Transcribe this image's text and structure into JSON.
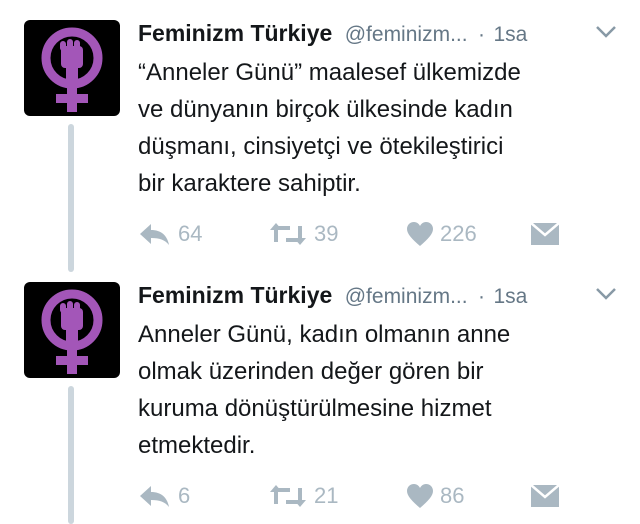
{
  "colors": {
    "accent_purple": "#a356b8",
    "icon_gray": "#aab8c2",
    "thread_line": "#ccd6dd",
    "meta_gray": "#657786"
  },
  "tweets": [
    {
      "name": "Feminizm Türkiye",
      "handle": "@feminizm...",
      "separator": "·",
      "time": "1sa",
      "text": "“Anneler Günü” maalesef ülkemizde\nve dünyanın birçok ülkesinde kadın\ndüşmanı, cinsiyetçi ve ötekileştirici\nbir karaktere sahiptir.",
      "reply_count": "64",
      "retweet_count": "39",
      "like_count": "226",
      "icons": [
        "reply-icon",
        "retweet-icon",
        "heart-icon",
        "dm-icon",
        "chevron-down-icon"
      ]
    },
    {
      "name": "Feminizm Türkiye",
      "handle": "@feminizm...",
      "separator": "·",
      "time": "1sa",
      "text": "Anneler Günü, kadın olmanın anne\nolmak üzerinden değer gören bir\nkuruma dönüştürülmesine hizmet\netmektedir.",
      "reply_count": "6",
      "retweet_count": "21",
      "like_count": "86",
      "icons": [
        "reply-icon",
        "retweet-icon",
        "heart-icon",
        "dm-icon",
        "chevron-down-icon"
      ]
    }
  ]
}
